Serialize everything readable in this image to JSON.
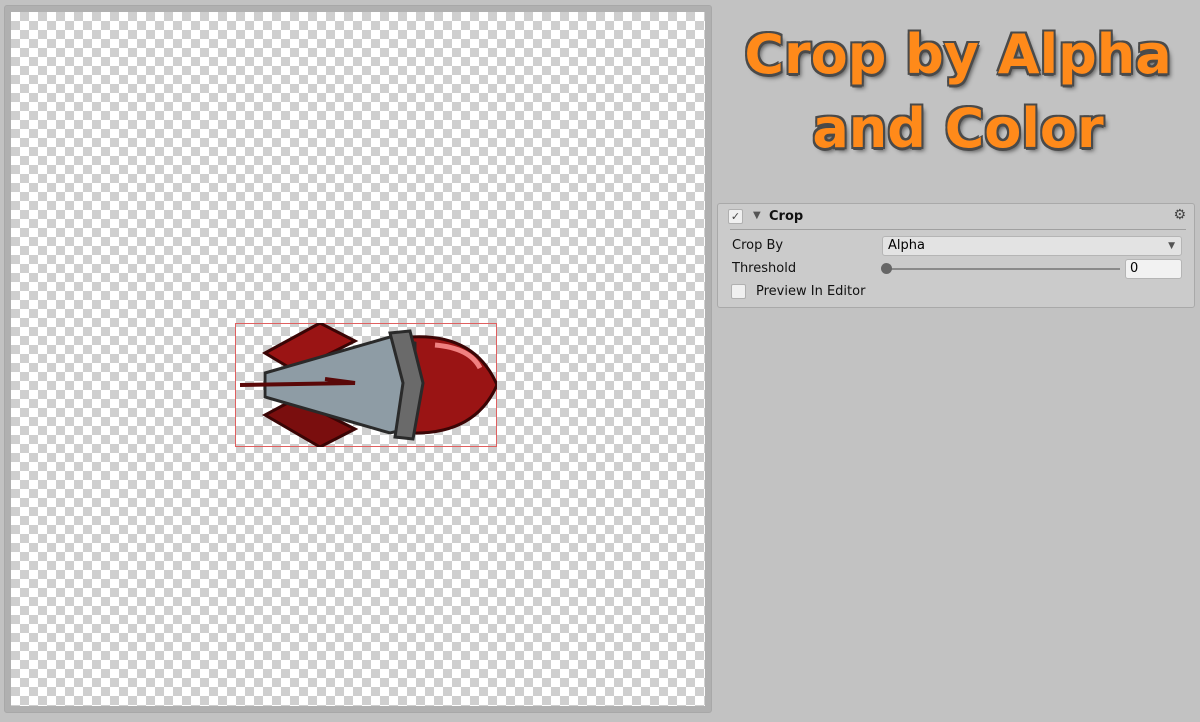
{
  "title": {
    "line1": "Crop by Alpha",
    "line2": "and Color"
  },
  "panel": {
    "enabled": true,
    "header": "Crop",
    "crop_by_label": "Crop By",
    "crop_by_value": "Alpha",
    "threshold_label": "Threshold",
    "threshold_value": "0",
    "threshold_fraction": 0,
    "preview_label": "Preview In Editor",
    "preview_checked": false
  },
  "colors": {
    "title": "#ff8a1a",
    "crop_rect": "#e06060",
    "rocket_body": "#9a1414"
  },
  "icons": {
    "check": "✓",
    "foldout": "▼",
    "gear": "⚙",
    "dropdown": "▼"
  }
}
